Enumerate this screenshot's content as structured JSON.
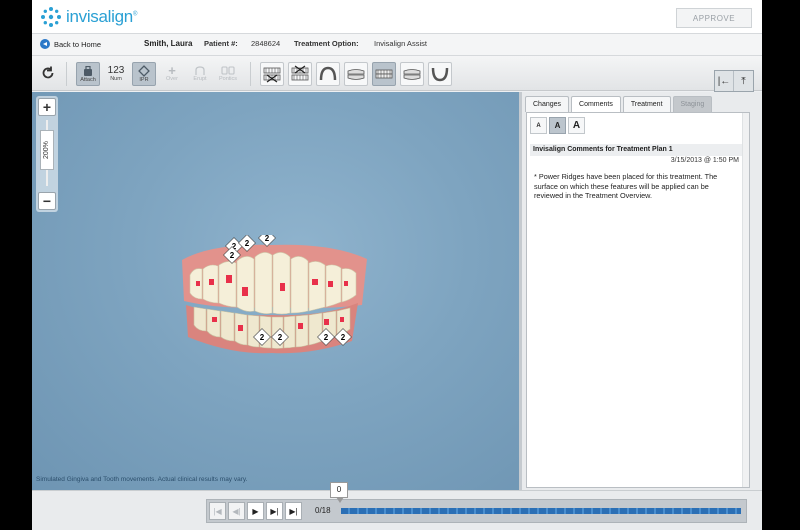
{
  "header": {
    "logo_text": "invisalign",
    "logo_reg": "®",
    "approve_label": "APPROVE"
  },
  "patient_bar": {
    "back_label": "Back to Home",
    "patient_name": "Smith, Laura",
    "patient_num_label": "Patient #:",
    "patient_num": "2848624",
    "treatment_label": "Treatment Option:",
    "treatment_value": "Invisalign Assist"
  },
  "toolbar": {
    "tools": [
      {
        "label": "Attach",
        "icon": "attach-icon",
        "state": "active"
      },
      {
        "label": "Num",
        "icon": "123",
        "state": "normal"
      },
      {
        "label": "IPR",
        "icon": "ipr-icon",
        "state": "active"
      },
      {
        "label": "Over",
        "icon": "plus-icon",
        "state": "disabled"
      },
      {
        "label": "Erupt",
        "icon": "erupt-icon",
        "state": "disabled"
      },
      {
        "label": "Pontics",
        "icon": "pontics-icon",
        "state": "disabled"
      }
    ]
  },
  "viewport": {
    "zoom_in": "+",
    "zoom_out": "−",
    "zoom_level": "200%",
    "disclaimer": "Simulated Gingiva and Tooth movements.  Actual clinical results may vary.",
    "ipr_labels": [
      "2",
      "2",
      "2",
      "2",
      "2",
      "2",
      "2",
      "2"
    ]
  },
  "side_panel": {
    "tabs": [
      {
        "label": "Changes",
        "state": "normal"
      },
      {
        "label": "Comments",
        "state": "active"
      },
      {
        "label": "Treatment",
        "state": "normal"
      },
      {
        "label": "Staging",
        "state": "disabled"
      }
    ],
    "font_sizes": [
      "A",
      "A",
      "A"
    ],
    "comment_header": "Invisalign Comments for Treatment Plan 1",
    "comment_date": "3/15/2013 @ 1:50 PM",
    "comment_body": "* Power Ridges have been placed for this treatment. The surface on which these features will be applied can be reviewed in the Treatment Overview."
  },
  "player": {
    "stage_count": "0/18",
    "current_stage": "0"
  },
  "colors": {
    "brand": "#2aa0d4",
    "viewport_bg": "#7ea4c0",
    "progress": "#2b6fb5"
  }
}
